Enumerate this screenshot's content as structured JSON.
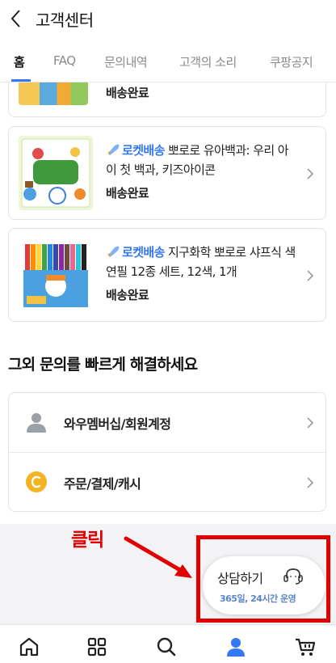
{
  "header": {
    "title": "고객센터"
  },
  "tabs": [
    {
      "label": "홈",
      "active": true
    },
    {
      "label": "FAQ",
      "active": false
    },
    {
      "label": "문의내역",
      "active": false
    },
    {
      "label": "고객의 소리",
      "active": false
    },
    {
      "label": "쿠팡공지",
      "active": false
    }
  ],
  "orders": {
    "partial_status": "배송완료",
    "items": [
      {
        "tag": "로켓배송",
        "title": " 뽀로로 유아백과: 우리 아이 첫 백과, 키즈아이콘",
        "status": "배송완료"
      },
      {
        "tag": "로켓배송",
        "title": " 지구화학 뽀로로 샤프식 색연필 12종 세트, 12색, 1개",
        "status": "배송완료"
      }
    ]
  },
  "quick_help": {
    "title": "그외 문의를 빠르게 해결하세요",
    "items": [
      {
        "label": "와우멤버십/회원계정",
        "icon": "user-icon"
      },
      {
        "label": "주문/결제/캐시",
        "icon": "coin-icon"
      }
    ]
  },
  "annotation": {
    "text": "클릭"
  },
  "consult": {
    "label": "상담하기",
    "sub": "365일, 24시간 운영"
  },
  "bottom_nav": [
    "home-icon",
    "grid-icon",
    "search-icon",
    "person-icon",
    "cart-icon"
  ],
  "colors": {
    "accent": "#3478f6",
    "annotation": "#e00000",
    "user_icon": "#9aa0a8",
    "coin_icon": "#f4b320"
  }
}
